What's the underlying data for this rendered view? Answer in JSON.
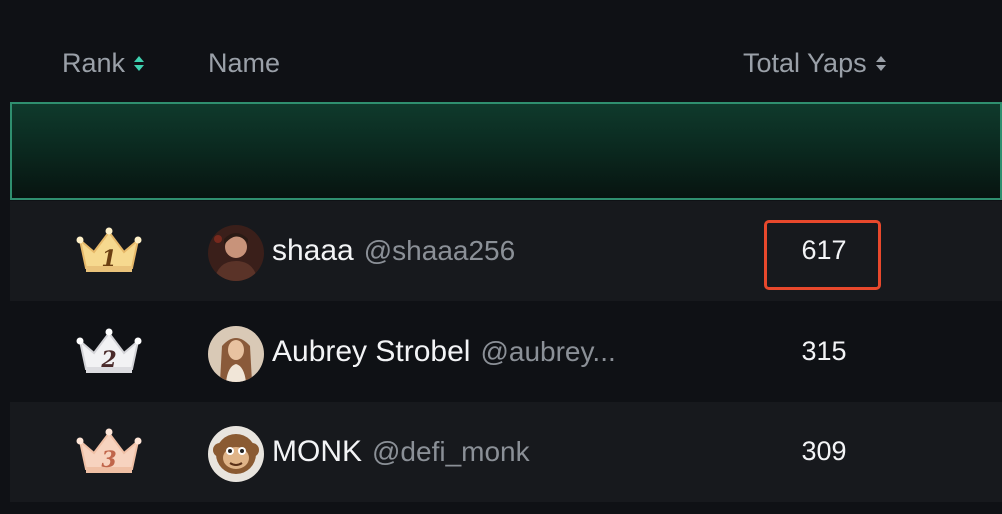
{
  "table": {
    "headers": {
      "rank": "Rank",
      "name": "Name",
      "total_yaps": "Total Yaps"
    },
    "sort_icons": [
      "sort-icon-active",
      "sort-icon"
    ],
    "accent_color": "#3fd1b0",
    "rows": [
      {
        "rank": "1",
        "name": "shaaa",
        "handle": "@shaaa256",
        "yaps": "617",
        "crown": "gold-crown-icon",
        "highlighted": true
      },
      {
        "rank": "2",
        "name": "Aubrey Strobel",
        "handle": "@aubrey...",
        "yaps": "315",
        "crown": "silver-crown-icon",
        "highlighted": false
      },
      {
        "rank": "3",
        "name": "MONK",
        "handle": "@defi_monk",
        "yaps": "309",
        "crown": "bronze-crown-icon",
        "highlighted": false
      }
    ]
  },
  "colors": {
    "highlight_border": "#e8482c",
    "banner_border": "#2f8f6f",
    "gold": "#e7b96a",
    "silver": "#e9e9ec",
    "bronze": "#f0c0a6"
  }
}
